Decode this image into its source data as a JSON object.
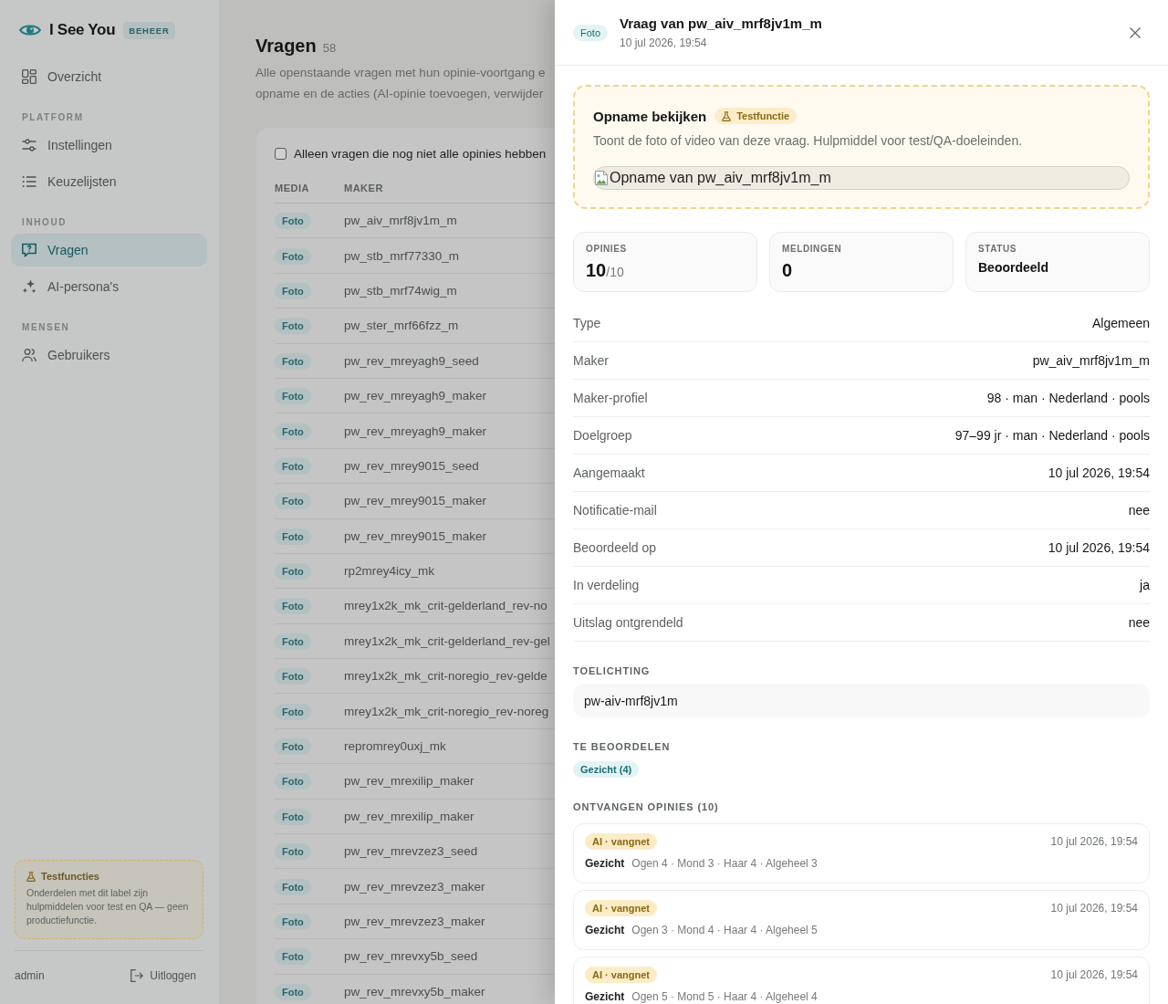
{
  "sidebar": {
    "brand": {
      "name": "I See You",
      "badge": "BEHEER"
    },
    "sections": [
      {
        "items": [
          {
            "label": "Overzicht",
            "selected": false
          }
        ]
      },
      {
        "heading": "PLATFORM",
        "items": [
          {
            "label": "Instellingen",
            "selected": false
          },
          {
            "label": "Keuzelijsten",
            "selected": false
          }
        ]
      },
      {
        "heading": "INHOUD",
        "items": [
          {
            "label": "Vragen",
            "selected": true
          },
          {
            "label": "AI-persona's",
            "selected": false
          }
        ]
      },
      {
        "heading": "MENSEN",
        "items": [
          {
            "label": "Gebruikers",
            "selected": false
          }
        ]
      }
    ],
    "test_notice": {
      "title": "Testfuncties",
      "text": "Onderdelen met dit label zijn hulpmiddelen voor test en QA — geen productiefunctie."
    },
    "footer": {
      "user": "admin",
      "logout": "Uitloggen"
    }
  },
  "main": {
    "title": "Vragen",
    "count": "58",
    "description_lines": [
      "Alle openstaande vragen met hun opinie-voortgang e",
      "opname en de acties (AI-opinie toevoegen, verwijder"
    ],
    "filter": {
      "label": "Alleen vragen die nog niet alle opinies hebben",
      "checked": false
    },
    "table": {
      "columns": [
        "MEDIA",
        "MAKER"
      ],
      "rows": [
        {
          "media": "Foto",
          "maker": "pw_aiv_mrf8jv1m_m"
        },
        {
          "media": "Foto",
          "maker": "pw_stb_mrf77330_m"
        },
        {
          "media": "Foto",
          "maker": "pw_stb_mrf74wig_m"
        },
        {
          "media": "Foto",
          "maker": "pw_ster_mrf66fzz_m"
        },
        {
          "media": "Foto",
          "maker": "pw_rev_mreyagh9_seed"
        },
        {
          "media": "Foto",
          "maker": "pw_rev_mreyagh9_maker"
        },
        {
          "media": "Foto",
          "maker": "pw_rev_mreyagh9_maker"
        },
        {
          "media": "Foto",
          "maker": "pw_rev_mrey9015_seed"
        },
        {
          "media": "Foto",
          "maker": "pw_rev_mrey9015_maker"
        },
        {
          "media": "Foto",
          "maker": "pw_rev_mrey9015_maker"
        },
        {
          "media": "Foto",
          "maker": "rp2mrey4icy_mk"
        },
        {
          "media": "Foto",
          "maker": "mrey1x2k_mk_crit-gelderland_rev-no"
        },
        {
          "media": "Foto",
          "maker": "mrey1x2k_mk_crit-gelderland_rev-gel"
        },
        {
          "media": "Foto",
          "maker": "mrey1x2k_mk_crit-noregio_rev-gelde"
        },
        {
          "media": "Foto",
          "maker": "mrey1x2k_mk_crit-noregio_rev-noreg"
        },
        {
          "media": "Foto",
          "maker": "repromrey0uxj_mk"
        },
        {
          "media": "Foto",
          "maker": "pw_rev_mrexilip_maker"
        },
        {
          "media": "Foto",
          "maker": "pw_rev_mrexilip_maker"
        },
        {
          "media": "Foto",
          "maker": "pw_rev_mrevzez3_seed"
        },
        {
          "media": "Foto",
          "maker": "pw_rev_mrevzez3_maker"
        },
        {
          "media": "Foto",
          "maker": "pw_rev_mrevzez3_maker"
        },
        {
          "media": "Foto",
          "maker": "pw_rev_mrevxy5b_seed"
        },
        {
          "media": "Foto",
          "maker": "pw_rev_mrevxy5b_maker"
        }
      ]
    }
  },
  "drawer": {
    "media": "Foto",
    "title": "Vraag van pw_aiv_mrf8jv1m_m",
    "subtitle": "10 jul 2026, 19:54",
    "test_panel": {
      "title": "Opname bekijken",
      "badge": "Testfunctie",
      "text": "Toont de foto of video van deze vraag. Hulpmiddel voor test/QA-doeleinden.",
      "image_alt": "Opname van pw_aiv_mrf8jv1m_m"
    },
    "stats": [
      {
        "kind": "count",
        "label": "OPINIES",
        "value": "10",
        "total": "/10"
      },
      {
        "kind": "count",
        "label": "MELDINGEN",
        "value": "0"
      },
      {
        "kind": "text",
        "label": "STATUS",
        "value": "Beoordeeld"
      }
    ],
    "details": [
      {
        "label": "Type",
        "value": "Algemeen"
      },
      {
        "label": "Maker",
        "value": "pw_aiv_mrf8jv1m_m"
      },
      {
        "label": "Maker-profiel",
        "value": "98 · man · Nederland · pools"
      },
      {
        "label": "Doelgroep",
        "value": "97–99 jr · man · Nederland · pools"
      },
      {
        "label": "Aangemaakt",
        "value": "10 jul 2026, 19:54"
      },
      {
        "label": "Notificatie-mail",
        "value": "nee"
      },
      {
        "label": "Beoordeeld op",
        "value": "10 jul 2026, 19:54"
      },
      {
        "label": "In verdeling",
        "value": "ja"
      },
      {
        "label": "Uitslag ontgrendeld",
        "value": "nee"
      }
    ],
    "explanation": {
      "heading": "TOELICHTING",
      "text": "pw-aiv-mrf8jv1m"
    },
    "to_assess": {
      "heading": "TE BEOORDELEN",
      "tags": [
        "Gezicht (4)"
      ]
    },
    "opinions": {
      "heading": "ONTVANGEN OPINIES (10)",
      "items": [
        {
          "source": "AI · vangnet",
          "date": "10 jul 2026, 19:54",
          "category": "Gezicht",
          "scores": "Ogen 4 · Mond 3 · Haar 4 · Algeheel 3"
        },
        {
          "source": "AI · vangnet",
          "date": "10 jul 2026, 19:54",
          "category": "Gezicht",
          "scores": "Ogen 3 · Mond 4 · Haar 4 · Algeheel 5"
        },
        {
          "source": "AI · vangnet",
          "date": "10 jul 2026, 19:54",
          "category": "Gezicht",
          "scores": "Ogen 5 · Mond 5 · Haar 4 · Algeheel 4"
        }
      ]
    }
  }
}
